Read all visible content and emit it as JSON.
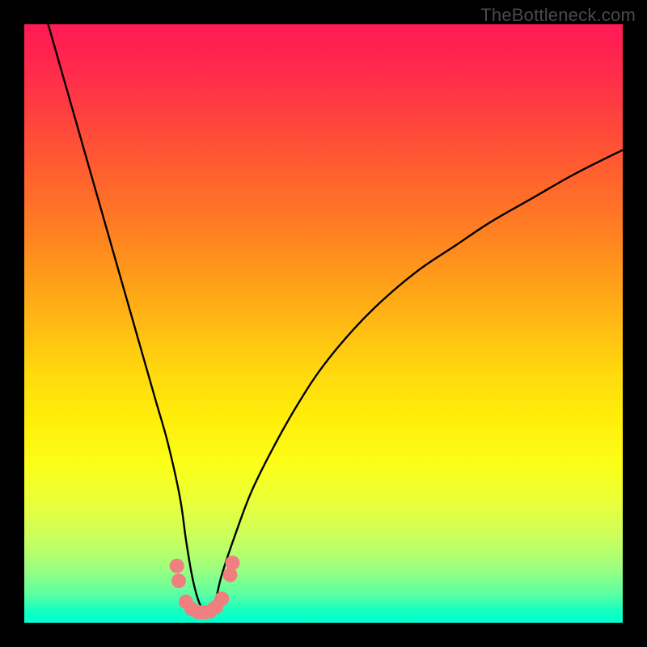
{
  "watermark": "TheBottleneck.com",
  "chart_data": {
    "type": "line",
    "title": "",
    "xlabel": "",
    "ylabel": "",
    "xlim": [
      0,
      100
    ],
    "ylim": [
      0,
      100
    ],
    "series": [
      {
        "name": "bottleneck-curve",
        "x": [
          4,
          6,
          8,
          10,
          12,
          14,
          16,
          18,
          20,
          22,
          24,
          26,
          27,
          28,
          29,
          30,
          31,
          32,
          33,
          35,
          38,
          42,
          46,
          50,
          55,
          60,
          66,
          72,
          78,
          85,
          92,
          100
        ],
        "values": [
          100,
          93,
          86,
          79,
          72,
          65,
          58,
          51,
          44,
          37,
          30,
          21,
          14,
          8,
          4,
          2,
          2,
          4,
          8,
          14,
          22,
          30,
          37,
          43,
          49,
          54,
          59,
          63,
          67,
          71,
          75,
          79
        ]
      }
    ],
    "markers": {
      "name": "highlight-dots",
      "color": "#f08080",
      "points": [
        {
          "x": 25.5,
          "y": 9.5
        },
        {
          "x": 25.8,
          "y": 7.0
        },
        {
          "x": 27.0,
          "y": 3.5
        },
        {
          "x": 28.0,
          "y": 2.3
        },
        {
          "x": 29.0,
          "y": 1.8
        },
        {
          "x": 30.0,
          "y": 1.7
        },
        {
          "x": 31.0,
          "y": 1.9
        },
        {
          "x": 32.0,
          "y": 2.6
        },
        {
          "x": 33.0,
          "y": 4.0
        },
        {
          "x": 34.4,
          "y": 8.0
        },
        {
          "x": 34.8,
          "y": 10.0
        }
      ]
    },
    "gradient_stops": [
      {
        "pos": 0.0,
        "color": "#ff1a55"
      },
      {
        "pos": 0.5,
        "color": "#ffd80e"
      },
      {
        "pos": 0.8,
        "color": "#e9ff3a"
      },
      {
        "pos": 1.0,
        "color": "#00ffd2"
      }
    ]
  }
}
